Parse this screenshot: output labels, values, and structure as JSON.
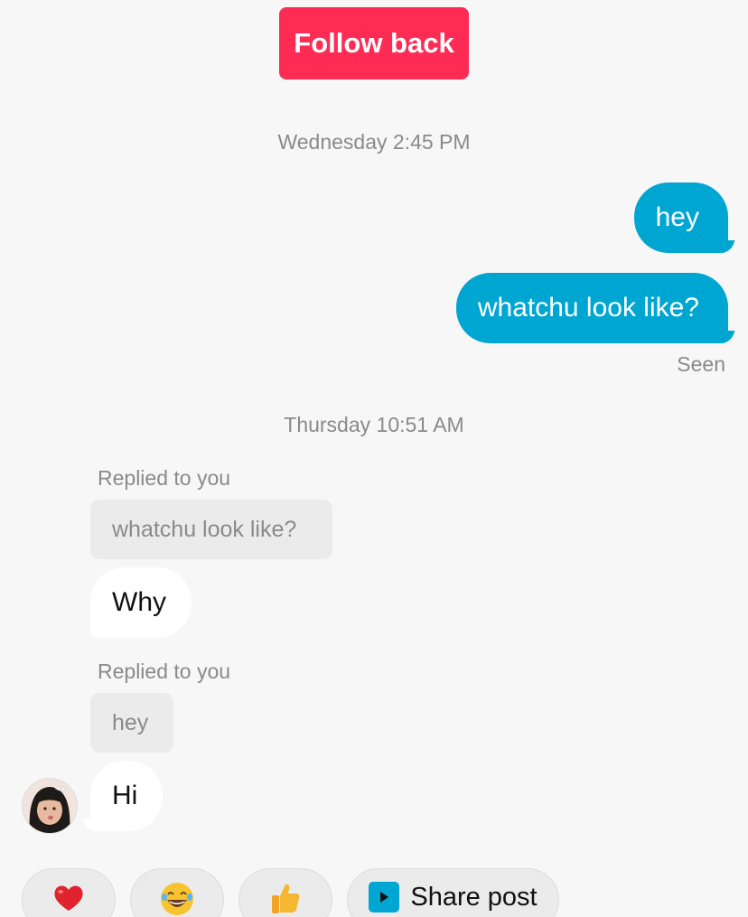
{
  "follow_back_label": "Follow back",
  "timestamps": [
    "Wednesday 2:45 PM",
    "Thursday 10:51 AM"
  ],
  "outgoing": [
    "hey",
    "whatchu look like?"
  ],
  "seen_label": "Seen",
  "incoming": [
    {
      "replied_label": "Replied to you",
      "quoted": "whatchu look like?",
      "text": "Why"
    },
    {
      "replied_label": "Replied to you",
      "quoted": "hey",
      "text": "Hi"
    }
  ],
  "quick_reactions": [
    {
      "icon": "heart-icon",
      "color": "#e0232e"
    },
    {
      "icon": "laughing-face-icon",
      "color": "#f7c331"
    },
    {
      "icon": "thumbs-up-icon",
      "color": "#f5b731"
    }
  ],
  "share_post_label": "Share post",
  "colors": {
    "follow_button": "#fe2c55",
    "outgoing_bubble": "#00a6d2",
    "incoming_bubble": "#ffffff",
    "background": "#f7f7f7"
  }
}
